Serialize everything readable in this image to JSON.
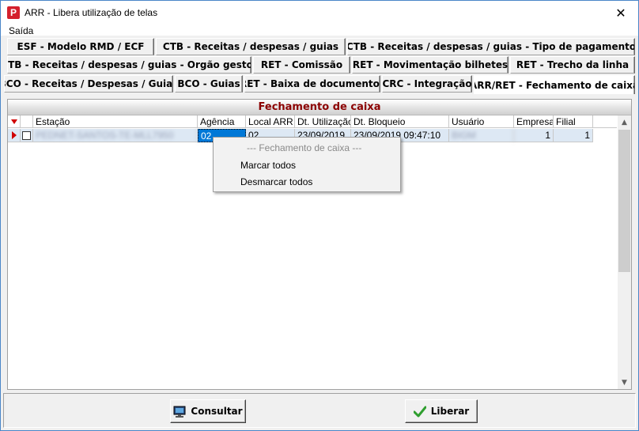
{
  "window": {
    "title": "ARR - Libera utilização de telas",
    "app_icon": "P",
    "close": "✕"
  },
  "menu": {
    "items": [
      {
        "label": "Saída"
      }
    ]
  },
  "tabs": {
    "row1": [
      {
        "label": "ESF - Modelo RMD / ECF"
      },
      {
        "label": "CTB - Receitas / despesas / guias"
      },
      {
        "label": "CTB - Receitas / despesas / guias - Tipo de pagamento"
      }
    ],
    "row2": [
      {
        "label": "CTB - Receitas / despesas / guias - Orgão gestor"
      },
      {
        "label": "RET - Comissão"
      },
      {
        "label": "RET - Movimentação bilhetes"
      },
      {
        "label": "RET - Trecho da linha"
      }
    ],
    "row3": [
      {
        "label": "BCO - Receitas / Despesas / Guias"
      },
      {
        "label": "BCO - Guias"
      },
      {
        "label": "RET - Baixa de documentos"
      },
      {
        "label": "CRC - Integração"
      },
      {
        "label": "ARR/RET - Fechamento de caixa",
        "active": true
      }
    ]
  },
  "panel": {
    "title": "Fechamento de caixa"
  },
  "grid": {
    "columns": [
      "Estação",
      "Agência",
      "Local ARR",
      "Dt. Utilização",
      "Dt. Bloqueio",
      "Usuário",
      "Empresa",
      "Filial"
    ],
    "rows": [
      {
        "estacao": "PEDNET-SANTOS-TE-MLL7950",
        "agencia": "02",
        "local_arr": "02",
        "dt_utilizacao": "23/09/2019",
        "dt_bloqueio": "23/09/2019 09:47:10",
        "usuario": "BIGM",
        "empresa": "1",
        "filial": "1"
      }
    ]
  },
  "context_menu": {
    "header": "--- Fechamento de caixa ---",
    "items": [
      {
        "label": "Marcar todos"
      },
      {
        "label": "Desmarcar todos"
      }
    ]
  },
  "footer": {
    "consultar_label": "Consultar",
    "liberar_label": "Liberar"
  },
  "colors": {
    "accent_red": "#8b0000",
    "selection_blue": "#0078d7",
    "row_bg": "#dde8f4",
    "check_green": "#2e9e2e"
  }
}
